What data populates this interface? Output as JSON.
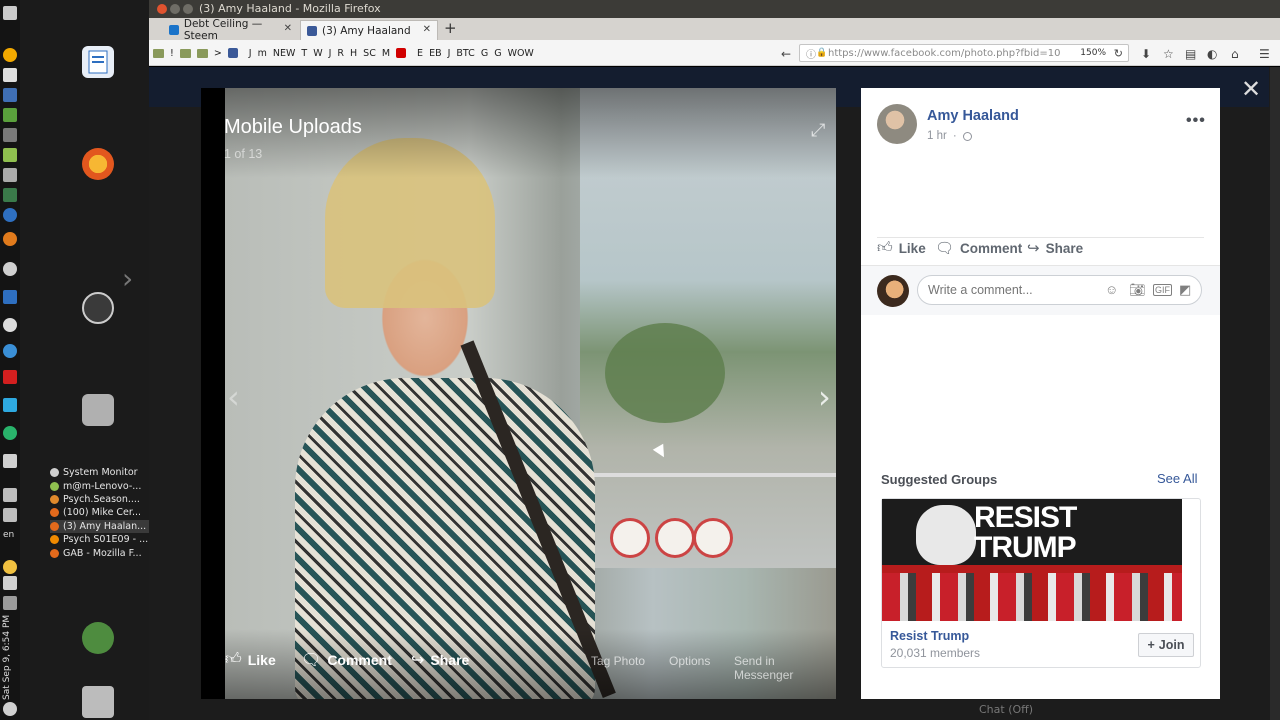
{
  "window": {
    "title": "(3) Amy Haaland - Mozilla Firefox",
    "tabs": [
      {
        "label": "Debt Ceiling — Steem"
      },
      {
        "label": "(3) Amy Haaland"
      }
    ],
    "new_tab": "+",
    "bookmarks": [
      "!",
      ">",
      "J",
      "m",
      "NEW",
      "T",
      "W",
      "J",
      "R",
      "H",
      "SC",
      "M",
      "E",
      "EB",
      "J",
      "BTC",
      "G",
      "G",
      "WOW"
    ],
    "url": "https://www.facebook.com/photo.php?fbid=10",
    "url_host": "facebook.com",
    "zoom": "150%"
  },
  "system": {
    "clock": "Sat Sep 9, 6:54 PM",
    "language": "en",
    "taskbar": [
      {
        "label": "System Monitor",
        "color": "#cfcfcf"
      },
      {
        "label": "m@m-Lenovo-...",
        "color": "#8fbf4f"
      },
      {
        "label": "Psych.Season....",
        "color": "#e08a2c"
      },
      {
        "label": "(100) Mike Cer...",
        "color": "#e36a1c"
      },
      {
        "label": "(3) Amy Haalan...",
        "color": "#e36a1c",
        "active": true
      },
      {
        "label": "Psych S01E09 - ...",
        "color": "#f08a00"
      },
      {
        "label": "GAB - Mozilla F...",
        "color": "#e36a1c"
      }
    ]
  },
  "viewer": {
    "album_title": "Mobile Uploads",
    "counter": "1 of 13",
    "actions": {
      "like": "Like",
      "comment": "Comment",
      "share": "Share",
      "tag_photo": "Tag Photo",
      "options": "Options",
      "send_messenger": "Send in Messenger"
    }
  },
  "post": {
    "author": "Amy Haaland",
    "time": "1 hr",
    "actions": {
      "like": "Like",
      "comment": "Comment",
      "share": "Share"
    },
    "comment_placeholder": "Write a comment..."
  },
  "suggested": {
    "title": "Suggested Groups",
    "see_all": "See All",
    "group": {
      "cover_text_1": "RESIST",
      "cover_text_2": "TRUMP",
      "name": "Resist Trump",
      "members": "20,031 members",
      "join": "Join"
    }
  },
  "chat": {
    "label": "Chat (Off)"
  }
}
